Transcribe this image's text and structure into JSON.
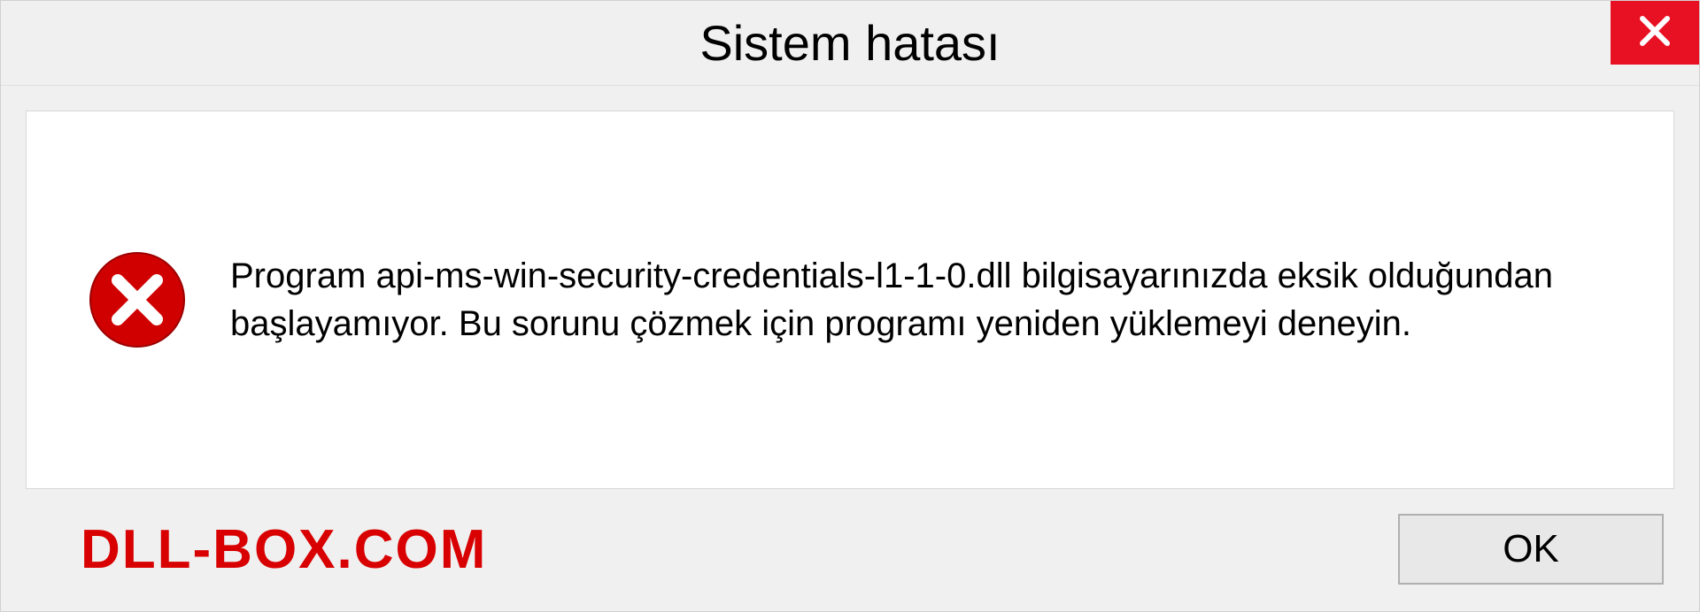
{
  "titlebar": {
    "title": "Sistem hatası"
  },
  "message": {
    "text": "Program api-ms-win-security-credentials-l1-1-0.dll bilgisayarınızda eksik olduğundan başlayamıyor. Bu sorunu çözmek için programı yeniden yüklemeyi deneyin."
  },
  "footer": {
    "watermark": "DLL-BOX.COM",
    "ok_label": "OK"
  }
}
